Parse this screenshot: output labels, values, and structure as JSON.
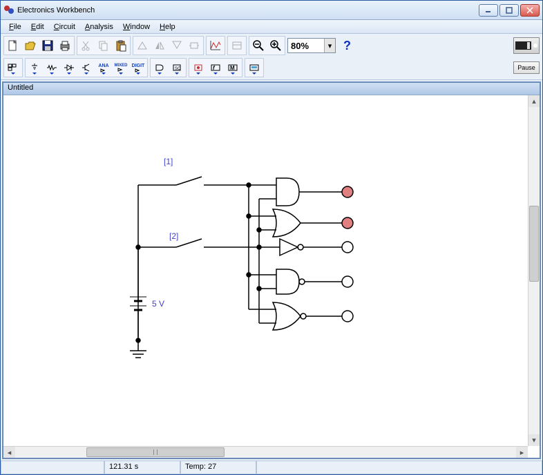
{
  "titlebar": {
    "title": "Electronics Workbench"
  },
  "menu": {
    "file": "File",
    "edit": "Edit",
    "circuit": "Circuit",
    "analysis": "Analysis",
    "window": "Window",
    "help": "Help"
  },
  "toolbar": {
    "zoom": "80%",
    "help": "?",
    "pause": "Pause",
    "parts_ana": "ANA",
    "parts_mixed": "MIXED",
    "parts_digit": "DIGIT"
  },
  "document": {
    "title": "Untitled"
  },
  "circuit": {
    "sw1_label": "[1]",
    "sw2_label": "[2]",
    "voltage": "5 V"
  },
  "status": {
    "time": "121.31 s",
    "temp": "Temp:  27"
  }
}
